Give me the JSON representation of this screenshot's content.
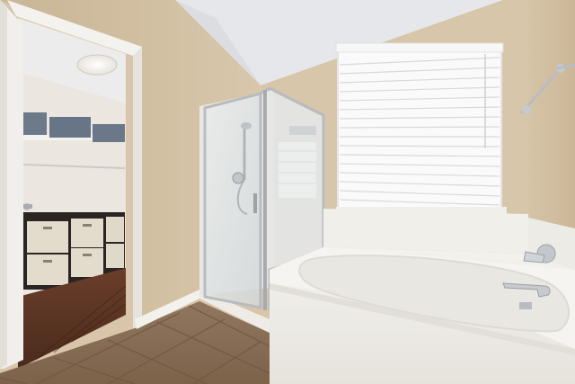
{
  "scene": {
    "kind": "photograph",
    "subject": "bathroom",
    "colors": {
      "wall": "#d4c2a6",
      "wall_shadow": "#c9b494",
      "ceiling": "#e8e8ea",
      "trim": "#f4f2ee",
      "floor_tile": "#8a6f55",
      "floor_grout": "#6e5844",
      "closet_floor": "#5a3424",
      "tub": "#f2f0ec",
      "glass": "#dde2e4",
      "chrome": "#c8ccd0",
      "blind": "#f6f6f6",
      "basket": "#e4dccd",
      "storage_bin": "#6c7a8a"
    }
  }
}
